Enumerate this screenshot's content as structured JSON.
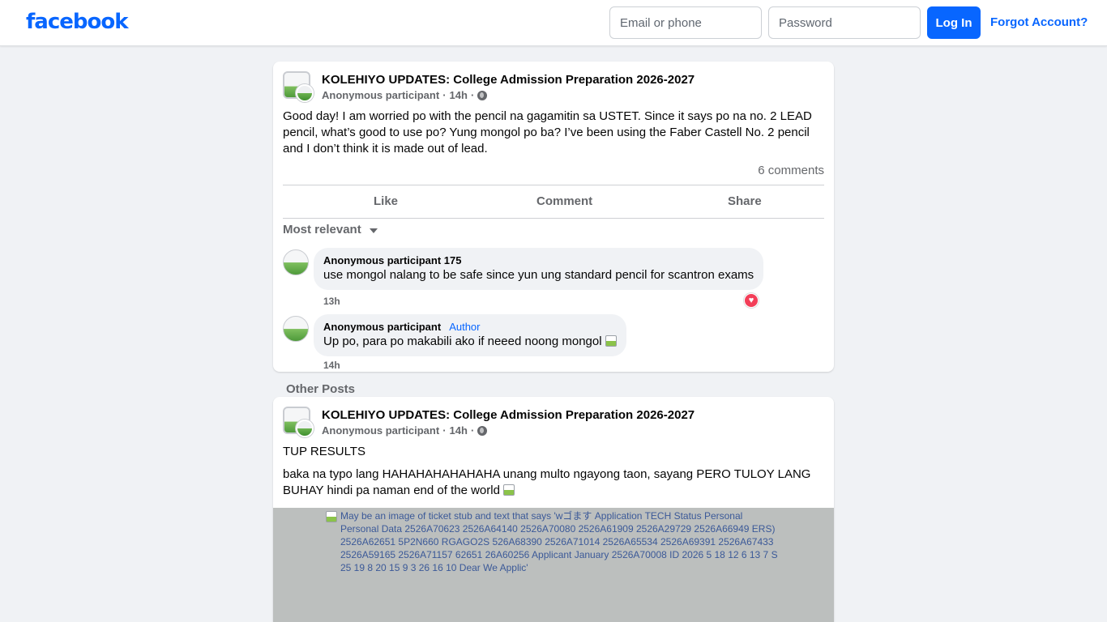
{
  "header": {
    "logo": "facebook",
    "email_placeholder": "Email or phone",
    "password_placeholder": "Password",
    "login_label": "Log In",
    "forgot_label": "Forgot Account?"
  },
  "post": {
    "group": "KOLEHIYO UPDATES: College Admission Preparation 2026-2027",
    "author": "Anonymous participant",
    "time": "14h",
    "text": "Good day! I am worried po with the pencil na gagamitin sa USTET. Since it says po na no. 2 LEAD pencil, what’s good to use po? Yung mongol po ba? I’ve been using the Faber Castell No. 2 pencil and I don’t think it is made out of lead.",
    "comments_count": "6 comments",
    "actions": {
      "like": "Like",
      "comment": "Comment",
      "share": "Share"
    },
    "sort_label": "Most relevant",
    "comments": [
      {
        "name": "Anonymous participant 175",
        "badge": "",
        "text": "use mongol nalang to be safe since yun ung standard pencil for scantron exams",
        "time": "13h",
        "reaction": "heart"
      },
      {
        "name": "Anonymous participant",
        "badge": "Author",
        "text": "Up po, para po makabili ako if neeed noong mongol",
        "time": "14h",
        "reaction": ""
      }
    ]
  },
  "other_posts_label": "Other Posts",
  "post2": {
    "group": "KOLEHIYO UPDATES: College Admission Preparation 2026-2027",
    "author": "Anonymous participant",
    "time": "14h",
    "line1": "TUP RESULTS",
    "line2": "baka na typo lang HAHAHAHAHAHAHA unang multo ngayong taon, sayang PERO TULOY LANG BUHAY hindi pa naman end of the world",
    "image_alt": "May be an image of ticket stub and text that says 'wゴます Application TECH Status Personal Personal Data 2526A70623 2526A64140 2526A70080 2526A61909 2526A29729 2526A66949 ERS) 2526A62651 5P2N660 RGAGO2S 526A68390 2526A71014 2526A65534 2526A69391 2526A67433 2526A59165 2526A71157 62651 26A60256 Applicant January 2526A70008 ID 2026 5 18 12 6 13 7 S 25 19 8 20 15 9 3 26 16 10 Dear We Applic'"
  },
  "colors": {
    "brand": "#0866ff",
    "background": "#f0f2f5",
    "reaction_heart": "#f33e58"
  }
}
